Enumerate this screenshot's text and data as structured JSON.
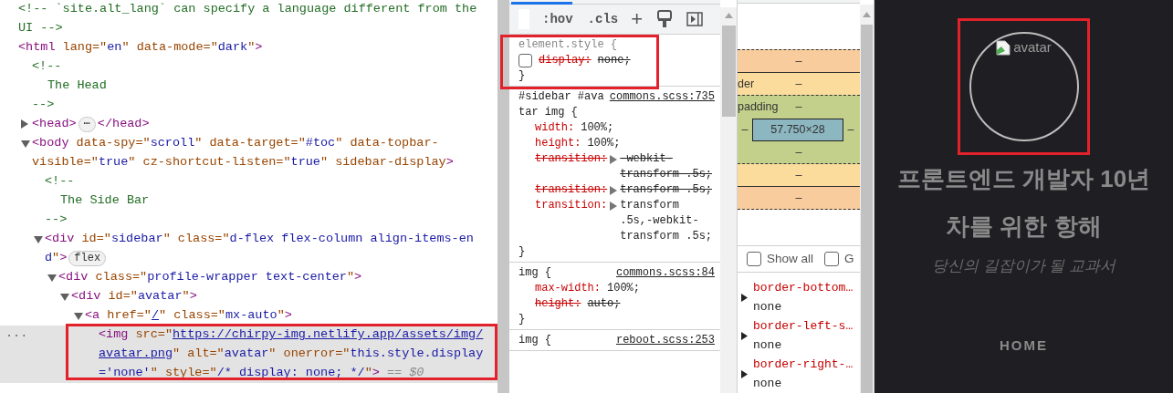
{
  "dom": [
    {
      "kind": "comment",
      "selected": false,
      "open": "<!-- `site.alt_lang` can specify a language different from the",
      "close": "UI -->"
    },
    {
      "kind": "element",
      "selected": false,
      "lines": [
        [
          {
            "kind": "tag",
            "text": "<html"
          },
          {
            "kind": "attr",
            "text": " lang=\""
          },
          {
            "kind": "value",
            "text": "en"
          },
          {
            "kind": "attr",
            "text": "\" data-mode=\""
          },
          {
            "kind": "value",
            "text": "dark"
          },
          {
            "kind": "attr",
            "text": "\""
          },
          {
            "kind": "tag",
            "text": ">"
          }
        ]
      ],
      "children": [
        {
          "kind": "comment",
          "selected": false,
          "open": "<!--",
          "body": "The Head",
          "close": "-->"
        },
        {
          "kind": "element",
          "selected": false,
          "expanded": false,
          "lines": [
            [
              {
                "kind": "tag",
                "text": "<head>"
              },
              {
                "kind": "badge",
                "text": "⋯"
              },
              {
                "kind": "tag",
                "text": "</head>"
              }
            ]
          ]
        },
        {
          "kind": "element",
          "selected": false,
          "expanded": true,
          "lines": [
            [
              {
                "kind": "tag",
                "text": "<body"
              },
              {
                "kind": "attr",
                "text": " data-spy=\""
              },
              {
                "kind": "value",
                "text": "scroll"
              },
              {
                "kind": "attr",
                "text": "\" data-target=\""
              },
              {
                "kind": "value",
                "text": "#toc"
              },
              {
                "kind": "attr",
                "text": "\" data-topbar-"
              }
            ],
            [
              {
                "kind": "attr",
                "text": "visible=\""
              },
              {
                "kind": "value",
                "text": "true"
              },
              {
                "kind": "attr",
                "text": "\" cz-shortcut-listen=\""
              },
              {
                "kind": "value",
                "text": "true"
              },
              {
                "kind": "attr",
                "text": "\" sidebar-display"
              },
              {
                "kind": "tag",
                "text": ">"
              }
            ]
          ],
          "children": [
            {
              "kind": "comment",
              "selected": false,
              "open": "<!--",
              "body": "The Side Bar",
              "close": "-->"
            },
            {
              "kind": "element",
              "selected": false,
              "expanded": true,
              "lines": [
                [
                  {
                    "kind": "tag",
                    "text": "<div"
                  },
                  {
                    "kind": "attr",
                    "text": " id=\""
                  },
                  {
                    "kind": "value",
                    "text": "sidebar"
                  },
                  {
                    "kind": "attr",
                    "text": "\" class=\""
                  },
                  {
                    "kind": "value",
                    "text": "d-flex flex-column align-items-en"
                  }
                ],
                [
                  {
                    "kind": "value",
                    "text": "d"
                  },
                  {
                    "kind": "attr",
                    "text": "\""
                  },
                  {
                    "kind": "tag",
                    "text": ">"
                  },
                  {
                    "kind": "badge",
                    "text": "flex"
                  }
                ]
              ],
              "children": [
                {
                  "kind": "element",
                  "selected": false,
                  "expanded": true,
                  "lines": [
                    [
                      {
                        "kind": "tag",
                        "text": "<div"
                      },
                      {
                        "kind": "attr",
                        "text": " class=\""
                      },
                      {
                        "kind": "value",
                        "text": "profile-wrapper text-center"
                      },
                      {
                        "kind": "attr",
                        "text": "\""
                      },
                      {
                        "kind": "tag",
                        "text": ">"
                      }
                    ]
                  ],
                  "children": [
                    {
                      "kind": "element",
                      "selected": false,
                      "expanded": true,
                      "lines": [
                        [
                          {
                            "kind": "tag",
                            "text": "<div"
                          },
                          {
                            "kind": "attr",
                            "text": " id=\""
                          },
                          {
                            "kind": "value",
                            "text": "avatar"
                          },
                          {
                            "kind": "attr",
                            "text": "\""
                          },
                          {
                            "kind": "tag",
                            "text": ">"
                          }
                        ]
                      ],
                      "children": [
                        {
                          "kind": "element",
                          "selected": false,
                          "expanded": true,
                          "lines": [
                            [
                              {
                                "kind": "tag",
                                "text": "<a"
                              },
                              {
                                "kind": "attr",
                                "text": " href=\""
                              },
                              {
                                "kind": "link",
                                "text": "/"
                              },
                              {
                                "kind": "attr",
                                "text": "\" class=\""
                              },
                              {
                                "kind": "value",
                                "text": "mx-auto"
                              },
                              {
                                "kind": "attr",
                                "text": "\""
                              },
                              {
                                "kind": "tag",
                                "text": ">"
                              }
                            ]
                          ],
                          "children": [
                            {
                              "kind": "element",
                              "selected": true,
                              "highlighted": true,
                              "gutter_mark": "...",
                              "lines": [
                                [
                                  {
                                    "kind": "tag",
                                    "text": "<img"
                                  },
                                  {
                                    "kind": "attr",
                                    "text": " src=\""
                                  },
                                  {
                                    "kind": "link",
                                    "text": "https://chirpy-img.netlify.app/assets/img/"
                                  }
                                ],
                                [
                                  {
                                    "kind": "link",
                                    "text": "avatar.png"
                                  },
                                  {
                                    "kind": "attr",
                                    "text": "\" alt=\""
                                  },
                                  {
                                    "kind": "value",
                                    "text": "avatar"
                                  },
                                  {
                                    "kind": "attr",
                                    "text": "\" onerror=\""
                                  },
                                  {
                                    "kind": "value",
                                    "text": "this.style.display"
                                  }
                                ],
                                [
                                  {
                                    "kind": "value",
                                    "text": "='none'"
                                  },
                                  {
                                    "kind": "attr",
                                    "text": "\" style=\""
                                  },
                                  {
                                    "kind": "value",
                                    "text": "/* display: none; */"
                                  },
                                  {
                                    "kind": "attr",
                                    "text": "\""
                                  },
                                  {
                                    "kind": "tag",
                                    "text": ">"
                                  },
                                  {
                                    "kind": "note",
                                    "text": "== $0"
                                  }
                                ]
                              ]
                            }
                          ]
                        }
                      ]
                    }
                  ]
                }
              ]
            }
          ]
        }
      ]
    }
  ],
  "styles": {
    "toolbar": {
      "hov": ":hov",
      "cls": ".cls",
      "add": "+"
    },
    "rules": [
      {
        "kind": "inline",
        "selector": "element.style {",
        "highlighted": true,
        "declarations": [
          {
            "name": "display:",
            "value": "none;",
            "overridden": true,
            "checkbox": {
              "checked": false
            }
          }
        ],
        "close": "}"
      },
      {
        "kind": "stylesheet",
        "selector": "#sidebar #avatar img {",
        "source": "commons.scss:735",
        "declarations": [
          {
            "name": "width:",
            "value": "100%;",
            "overridden": false
          },
          {
            "name": "height:",
            "value": "100%;",
            "overridden": false
          },
          {
            "name": "transition:",
            "value": "-webkit-transform .5s;",
            "overridden": true,
            "expandable": true
          },
          {
            "name": "transition:",
            "value": "transform .5s;",
            "overridden": true,
            "expandable": true
          },
          {
            "name": "transition:",
            "value": "transform .5s,-webkit-transform .5s;",
            "overridden": false,
            "expandable": true
          }
        ],
        "close": "}"
      },
      {
        "kind": "stylesheet",
        "selector": "img {",
        "source": "commons.scss:84",
        "declarations": [
          {
            "name": "max-width:",
            "value": "100%;",
            "overridden": false
          },
          {
            "name": "height:",
            "value": "auto;",
            "overridden": true
          }
        ],
        "close": "}"
      },
      {
        "kind": "stylesheet",
        "selector": "img {",
        "source": "reboot.scss:253"
      }
    ]
  },
  "computed": {
    "box_model": {
      "margin_top": "–",
      "border_label": "der",
      "border_top": "–",
      "padding_label": "padding",
      "padding_top": "–",
      "padding_left": "–",
      "content": "57.750×28",
      "padding_right": "–",
      "padding_bottom": "–",
      "border_bottom": "–",
      "margin_bottom": "–"
    },
    "filters": [
      {
        "label": "Show all",
        "checked": false
      },
      {
        "label": "G",
        "checked": false
      }
    ],
    "properties": [
      {
        "name": "border-bottom…",
        "value": "none",
        "expanded": false
      },
      {
        "name": "border-left-s…",
        "value": "none",
        "expanded": false
      },
      {
        "name": "border-right-…",
        "value": "none",
        "expanded": false
      }
    ]
  },
  "page": {
    "avatar": {
      "alt": "avatar",
      "highlighted": true
    },
    "title": "프론트엔드 개발자 10년 차를 위한 항해",
    "subtitle": "당신의 길잡이가 될 교과서",
    "nav": [
      {
        "label": "HOME"
      }
    ]
  }
}
